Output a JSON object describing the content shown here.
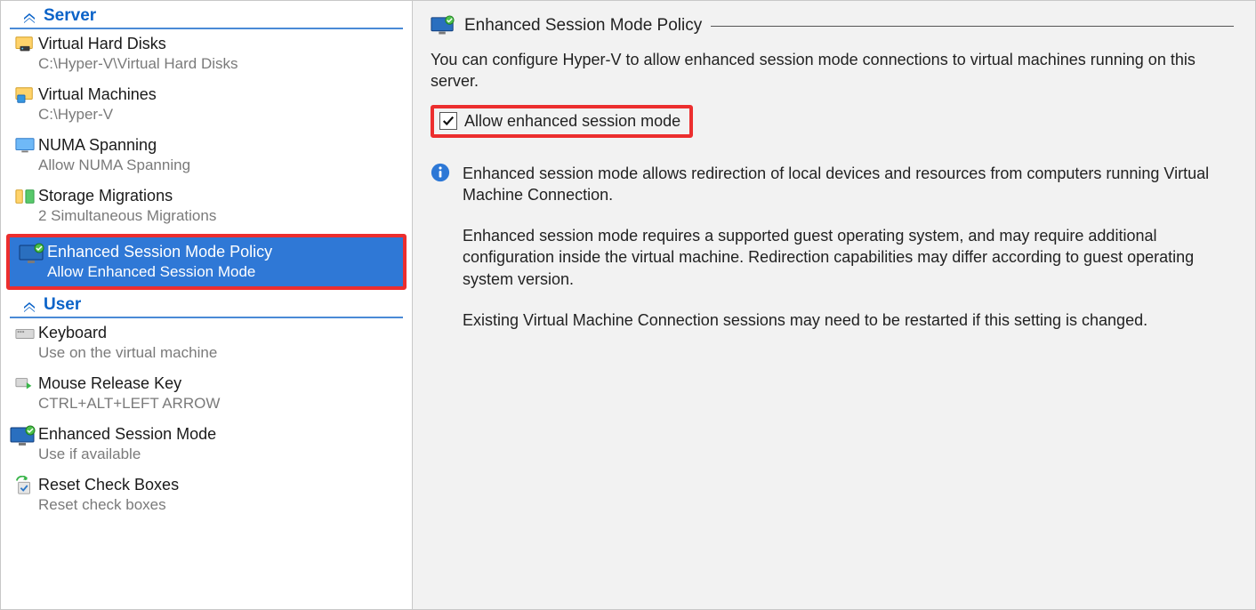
{
  "sidebar": {
    "sections": {
      "server": {
        "label": "Server",
        "items": [
          {
            "title": "Virtual Hard Disks",
            "sub": "C:\\Hyper-V\\Virtual Hard Disks"
          },
          {
            "title": "Virtual Machines",
            "sub": "C:\\Hyper-V"
          },
          {
            "title": "NUMA Spanning",
            "sub": "Allow NUMA Spanning"
          },
          {
            "title": "Storage Migrations",
            "sub": "2 Simultaneous Migrations"
          },
          {
            "title": "Enhanced Session Mode Policy",
            "sub": "Allow Enhanced Session Mode"
          }
        ]
      },
      "user": {
        "label": "User",
        "items": [
          {
            "title": "Keyboard",
            "sub": "Use on the virtual machine"
          },
          {
            "title": "Mouse Release Key",
            "sub": "CTRL+ALT+LEFT ARROW"
          },
          {
            "title": "Enhanced Session Mode",
            "sub": "Use if available"
          },
          {
            "title": "Reset Check Boxes",
            "sub": "Reset check boxes"
          }
        ]
      }
    }
  },
  "pane": {
    "title": "Enhanced Session Mode Policy",
    "desc": "You can configure Hyper-V to allow enhanced session mode connections to virtual machines running on this server.",
    "checkbox_label": "Allow enhanced session mode",
    "info": {
      "p1": "Enhanced session mode allows redirection of local devices and resources from computers running Virtual Machine Connection.",
      "p2": "Enhanced session mode requires a supported guest operating system, and may require additional configuration inside the virtual machine. Redirection capabilities may differ according to guest operating system version.",
      "p3": "Existing Virtual Machine Connection sessions may need to be restarted if this setting is changed."
    }
  }
}
